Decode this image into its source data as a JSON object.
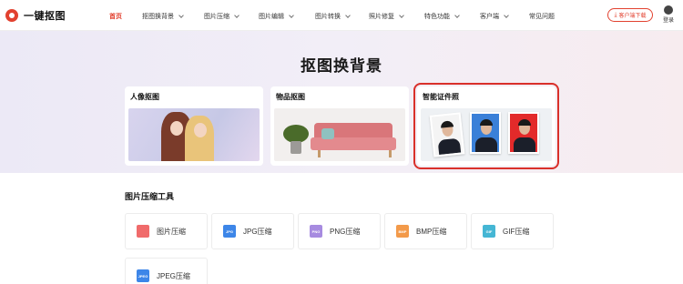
{
  "header": {
    "logo_text": "一键抠图",
    "nav": [
      {
        "label": "首页",
        "active": true,
        "dropdown": false
      },
      {
        "label": "抠图换背景",
        "active": false,
        "dropdown": true
      },
      {
        "label": "图片压缩",
        "active": false,
        "dropdown": true
      },
      {
        "label": "图片编辑",
        "active": false,
        "dropdown": true
      },
      {
        "label": "图片转换",
        "active": false,
        "dropdown": true
      },
      {
        "label": "照片修复",
        "active": false,
        "dropdown": true
      },
      {
        "label": "特色功能",
        "active": false,
        "dropdown": true
      },
      {
        "label": "客户端",
        "active": false,
        "dropdown": true
      },
      {
        "label": "常见问题",
        "active": false,
        "dropdown": false
      }
    ],
    "download_label": "客户端下载",
    "login_label": "登录"
  },
  "hero": {
    "title": "抠图换背景",
    "cards": [
      {
        "title": "人像抠图"
      },
      {
        "title": "物品抠图"
      },
      {
        "title": "智能证件照"
      }
    ]
  },
  "tools": {
    "section_title": "图片压缩工具",
    "items": [
      {
        "label": "图片压缩",
        "icon": "image-compress-icon",
        "icon_text": "",
        "color": "#f06b6b"
      },
      {
        "label": "JPG压缩",
        "icon": "jpg-icon",
        "icon_text": "JPG",
        "color": "#3d86e8"
      },
      {
        "label": "PNG压缩",
        "icon": "png-icon",
        "icon_text": "PNG",
        "color": "#a78be0"
      },
      {
        "label": "BMP压缩",
        "icon": "bmp-icon",
        "icon_text": "BMP",
        "color": "#f39a4a"
      },
      {
        "label": "GIF压缩",
        "icon": "gif-icon",
        "icon_text": "GIF",
        "color": "#45b6d4"
      },
      {
        "label": "JPEG压缩",
        "icon": "jpeg-icon",
        "icon_text": "JPEG",
        "color": "#3d86e8"
      }
    ]
  },
  "colors": {
    "accent": "#e2412f",
    "highlight_border": "#d9302a"
  }
}
